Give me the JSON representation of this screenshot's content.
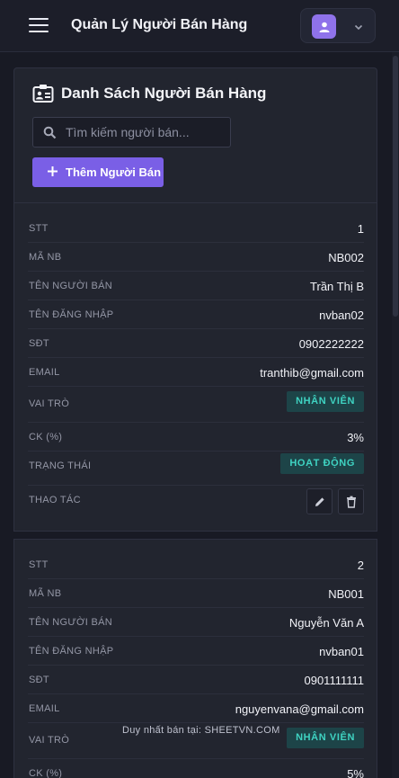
{
  "header": {
    "title": "Quản Lý Người Bán Hàng",
    "menu_icon": "hamburger-icon",
    "user_icon": "user-icon",
    "dropdown_icon": "chevron-down-icon"
  },
  "panel": {
    "title": "Danh Sách Người Bán Hàng",
    "title_icon": "id-card-icon",
    "search_placeholder": "Tìm kiếm người bán...",
    "add_button": "Thêm Người Bán"
  },
  "labels": {
    "stt": "STT",
    "code": "MÃ NB",
    "name": "TÊN NGƯỜI BÁN",
    "username": "TÊN ĐĂNG NHẬP",
    "phone": "SĐT",
    "email": "EMAIL",
    "role": "VAI TRÒ",
    "discount": "CK (%)",
    "status": "TRẠNG THÁI",
    "actions": "THAO TÁC"
  },
  "sellers": [
    {
      "stt": "1",
      "code": "NB002",
      "name": "Trần Thị B",
      "username": "nvban02",
      "phone": "0902222222",
      "email": "tranthib@gmail.com",
      "role": "NHÂN VIÊN",
      "discount": "3%",
      "status": "HOẠT ĐỘNG"
    },
    {
      "stt": "2",
      "code": "NB001",
      "name": "Nguyễn Văn A",
      "username": "nvban01",
      "phone": "0901111111",
      "email": "nguyenvana@gmail.com",
      "role": "NHÂN VIÊN",
      "discount": "5%"
    }
  ],
  "watermark": "Duy nhất bán tại: SHEETVN.COM",
  "colors": {
    "accent": "#7a5fe6",
    "badge_bg": "#1d4448",
    "badge_text": "#3fd3c2",
    "background": "#181a24"
  }
}
